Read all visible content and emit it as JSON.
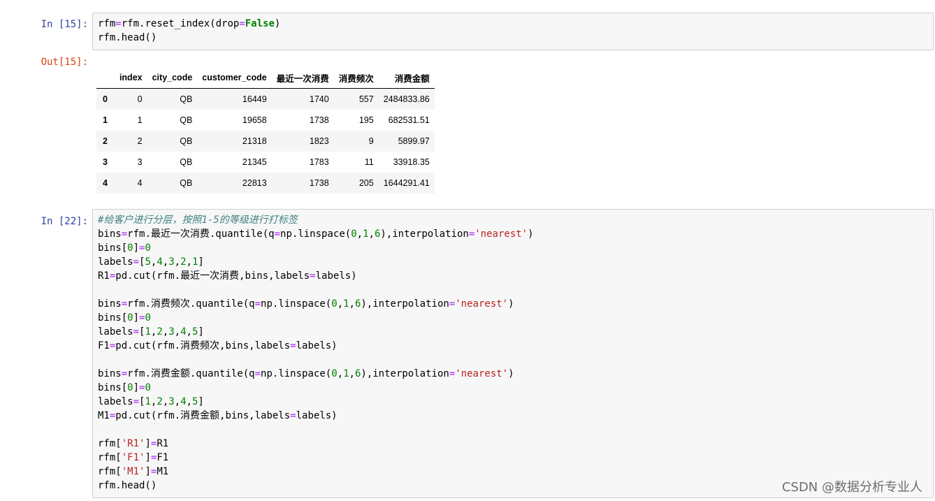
{
  "cells": [
    {
      "prompt": "In  [15]:",
      "lines": [
        [
          [
            "",
            "rfm"
          ],
          [
            "op",
            "="
          ],
          [
            "",
            "rfm.reset_index(drop"
          ],
          [
            "op",
            "="
          ],
          [
            "kw",
            "False"
          ],
          [
            "",
            ")"
          ]
        ],
        [
          [
            "",
            "rfm.head()"
          ]
        ]
      ]
    },
    {
      "prompt": "In  [22]:",
      "lines": [
        [
          [
            "com",
            "#给客户进行分层，按照1-5的等级进行打标签"
          ]
        ],
        [
          [
            "",
            "bins"
          ],
          [
            "op",
            "="
          ],
          [
            "",
            "rfm.最近一次消费.quantile(q"
          ],
          [
            "op",
            "="
          ],
          [
            "",
            "np.linspace("
          ],
          [
            "num",
            "0"
          ],
          [
            "",
            ","
          ],
          [
            "num",
            "1"
          ],
          [
            "",
            ","
          ],
          [
            "num",
            "6"
          ],
          [
            "",
            "),interpolation"
          ],
          [
            "op",
            "="
          ],
          [
            "str",
            "'nearest'"
          ],
          [
            "",
            ")"
          ]
        ],
        [
          [
            "",
            "bins["
          ],
          [
            "num",
            "0"
          ],
          [
            "",
            "]"
          ],
          [
            "op",
            "="
          ],
          [
            "num",
            "0"
          ]
        ],
        [
          [
            "",
            "labels"
          ],
          [
            "op",
            "="
          ],
          [
            "",
            "["
          ],
          [
            "num",
            "5"
          ],
          [
            "",
            ","
          ],
          [
            "num",
            "4"
          ],
          [
            "",
            ","
          ],
          [
            "num",
            "3"
          ],
          [
            "",
            ","
          ],
          [
            "num",
            "2"
          ],
          [
            "",
            ","
          ],
          [
            "num",
            "1"
          ],
          [
            "",
            "]"
          ]
        ],
        [
          [
            "",
            "R1"
          ],
          [
            "op",
            "="
          ],
          [
            "",
            "pd.cut(rfm.最近一次消费,bins,labels"
          ],
          [
            "op",
            "="
          ],
          [
            "",
            "labels)"
          ]
        ],
        [],
        [
          [
            "",
            "bins"
          ],
          [
            "op",
            "="
          ],
          [
            "",
            "rfm.消费频次.quantile(q"
          ],
          [
            "op",
            "="
          ],
          [
            "",
            "np.linspace("
          ],
          [
            "num",
            "0"
          ],
          [
            "",
            ","
          ],
          [
            "num",
            "1"
          ],
          [
            "",
            ","
          ],
          [
            "num",
            "6"
          ],
          [
            "",
            "),interpolation"
          ],
          [
            "op",
            "="
          ],
          [
            "str",
            "'nearest'"
          ],
          [
            "",
            ")"
          ]
        ],
        [
          [
            "",
            "bins["
          ],
          [
            "num",
            "0"
          ],
          [
            "",
            "]"
          ],
          [
            "op",
            "="
          ],
          [
            "num",
            "0"
          ]
        ],
        [
          [
            "",
            "labels"
          ],
          [
            "op",
            "="
          ],
          [
            "",
            "["
          ],
          [
            "num",
            "1"
          ],
          [
            "",
            ","
          ],
          [
            "num",
            "2"
          ],
          [
            "",
            ","
          ],
          [
            "num",
            "3"
          ],
          [
            "",
            ","
          ],
          [
            "num",
            "4"
          ],
          [
            "",
            ","
          ],
          [
            "num",
            "5"
          ],
          [
            "",
            "]"
          ]
        ],
        [
          [
            "",
            "F1"
          ],
          [
            "op",
            "="
          ],
          [
            "",
            "pd.cut(rfm.消费频次,bins,labels"
          ],
          [
            "op",
            "="
          ],
          [
            "",
            "labels)"
          ]
        ],
        [],
        [
          [
            "",
            "bins"
          ],
          [
            "op",
            "="
          ],
          [
            "",
            "rfm.消费金额.quantile(q"
          ],
          [
            "op",
            "="
          ],
          [
            "",
            "np.linspace("
          ],
          [
            "num",
            "0"
          ],
          [
            "",
            ","
          ],
          [
            "num",
            "1"
          ],
          [
            "",
            ","
          ],
          [
            "num",
            "6"
          ],
          [
            "",
            "),interpolation"
          ],
          [
            "op",
            "="
          ],
          [
            "str",
            "'nearest'"
          ],
          [
            "",
            ")"
          ]
        ],
        [
          [
            "",
            "bins["
          ],
          [
            "num",
            "0"
          ],
          [
            "",
            "]"
          ],
          [
            "op",
            "="
          ],
          [
            "num",
            "0"
          ]
        ],
        [
          [
            "",
            "labels"
          ],
          [
            "op",
            "="
          ],
          [
            "",
            "["
          ],
          [
            "num",
            "1"
          ],
          [
            "",
            ","
          ],
          [
            "num",
            "2"
          ],
          [
            "",
            ","
          ],
          [
            "num",
            "3"
          ],
          [
            "",
            ","
          ],
          [
            "num",
            "4"
          ],
          [
            "",
            ","
          ],
          [
            "num",
            "5"
          ],
          [
            "",
            "]"
          ]
        ],
        [
          [
            "",
            "M1"
          ],
          [
            "op",
            "="
          ],
          [
            "",
            "pd.cut(rfm.消费金额,bins,labels"
          ],
          [
            "op",
            "="
          ],
          [
            "",
            "labels)"
          ]
        ],
        [],
        [
          [
            "",
            "rfm["
          ],
          [
            "str",
            "'R1'"
          ],
          [
            "",
            "]"
          ],
          [
            "op",
            "="
          ],
          [
            "",
            "R1"
          ]
        ],
        [
          [
            "",
            "rfm["
          ],
          [
            "str",
            "'F1'"
          ],
          [
            "",
            "]"
          ],
          [
            "op",
            "="
          ],
          [
            "",
            "F1"
          ]
        ],
        [
          [
            "",
            "rfm["
          ],
          [
            "str",
            "'M1'"
          ],
          [
            "",
            "]"
          ],
          [
            "op",
            "="
          ],
          [
            "",
            "M1"
          ]
        ],
        [
          [
            "",
            "rfm.head()"
          ]
        ]
      ]
    }
  ],
  "output": {
    "prompt": "Out[15]:",
    "columns": [
      "",
      "index",
      "city_code",
      "customer_code",
      "最近一次消费",
      "消费频次",
      "消费金额"
    ],
    "rows": [
      [
        "0",
        "0",
        "QB",
        "16449",
        "1740",
        "557",
        "2484833.86"
      ],
      [
        "1",
        "1",
        "QB",
        "19658",
        "1738",
        "195",
        "682531.51"
      ],
      [
        "2",
        "2",
        "QB",
        "21318",
        "1823",
        "9",
        "5899.97"
      ],
      [
        "3",
        "3",
        "QB",
        "21345",
        "1783",
        "11",
        "33918.35"
      ],
      [
        "4",
        "4",
        "QB",
        "22813",
        "1738",
        "205",
        "1644291.41"
      ]
    ]
  },
  "watermark": "CSDN @数据分析专业人"
}
